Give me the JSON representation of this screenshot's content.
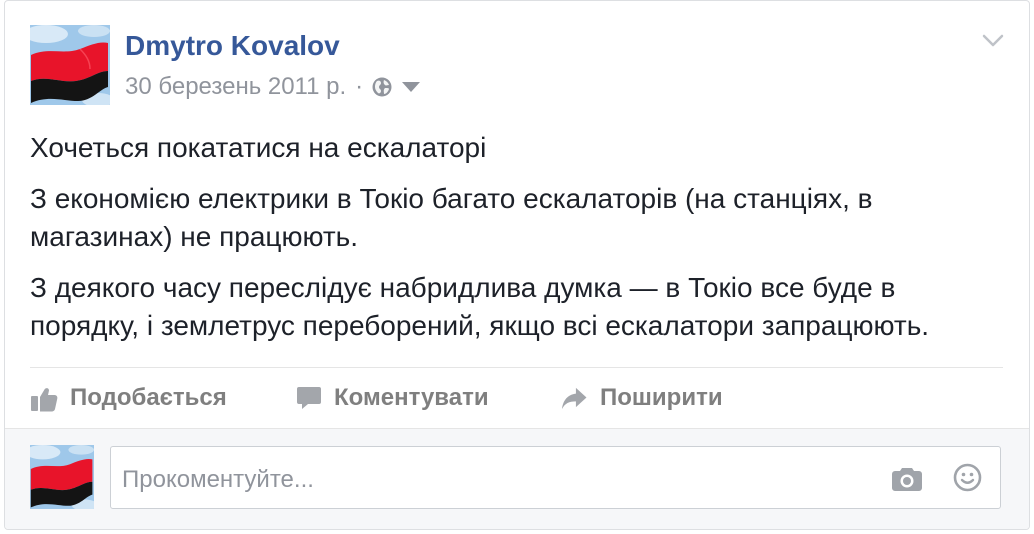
{
  "colors": {
    "author-link": "#365899",
    "post-text": "#1d2129",
    "secondary-text": "#90949c",
    "action-text": "#7f7f7f",
    "composer-bg": "#f6f7f9"
  },
  "header": {
    "author_name": "Dmytro Kovalov",
    "timestamp": "30 березень 2011 р.",
    "separator": "·",
    "privacy_icon": "globe-icon",
    "privacy_menu_icon": "caret-down-icon",
    "options_icon": "chevron-down-icon"
  },
  "post": {
    "paragraphs": [
      [
        "Хочеться покататися на ескалаторі"
      ],
      [
        "З економією електрики в Токіо багато ескалаторів (на станціях, в",
        "магазинах) не працюють."
      ],
      [
        "З деякого часу переслідує набридлива думка — в Токіо все буде в",
        "порядку, і землетрус переборений, якщо всі ескалатори запрацюють."
      ]
    ]
  },
  "actions": [
    {
      "label": "Подобається",
      "icon": "thumbs-up-icon"
    },
    {
      "label": "Коментувати",
      "icon": "comment-icon"
    },
    {
      "label": "Поширити",
      "icon": "share-icon"
    }
  ],
  "composer": {
    "placeholder": "Прокоментуйте...",
    "value": "",
    "icons": [
      "camera-icon",
      "smiley-icon"
    ]
  }
}
